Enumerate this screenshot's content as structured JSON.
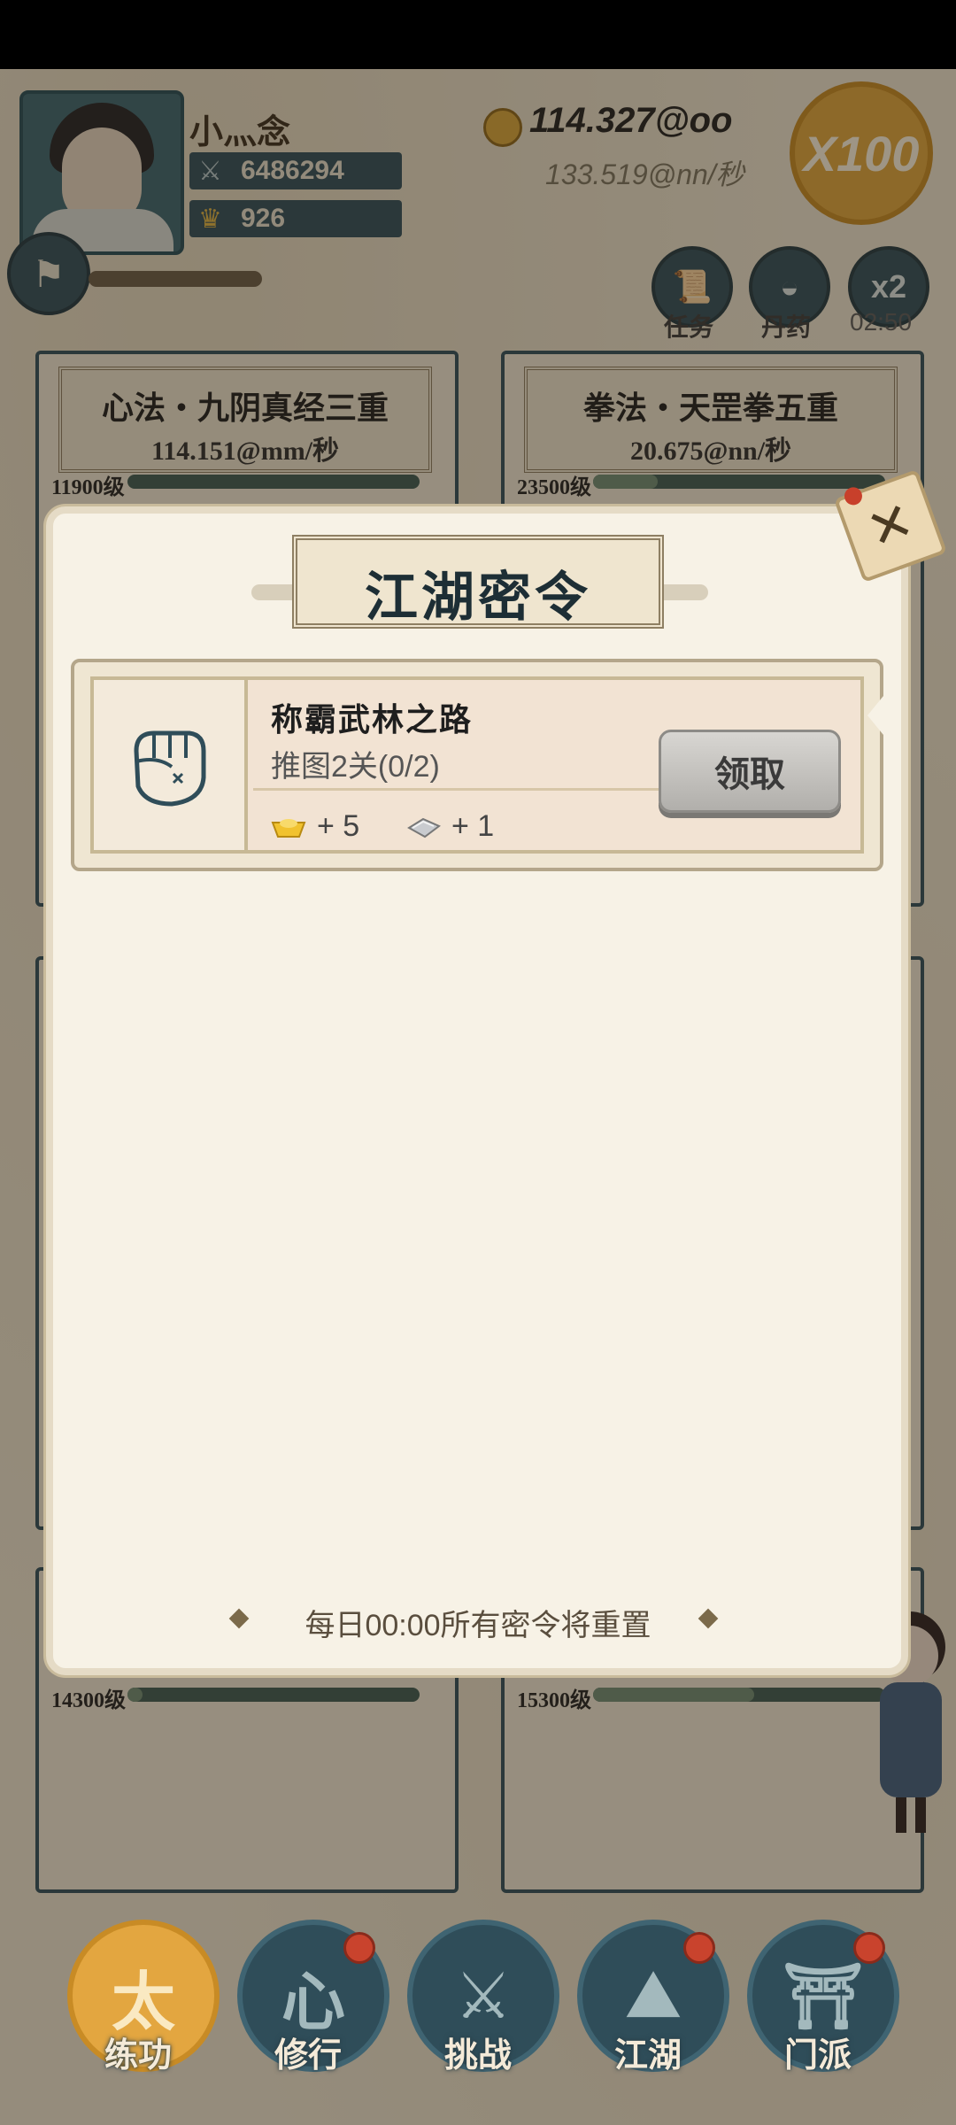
{
  "player": {
    "name": "小灬念",
    "power": "6486294",
    "ingots": "926"
  },
  "currency": {
    "gold": "114.327@oo",
    "rate": "133.519@nn/秒",
    "multiplier": "X100"
  },
  "actions": [
    {
      "icon": "scroll-icon",
      "label": "任务"
    },
    {
      "icon": "pill-icon",
      "label": "丹药"
    },
    {
      "icon": "speed-icon",
      "label": "x2",
      "timer": "02:50"
    }
  ],
  "cards": [
    {
      "title": "心法・九阴真经三重",
      "rate": "114.151@mm/秒",
      "level": "11900级",
      "progress": 0.0
    },
    {
      "title": "拳法・天罡拳五重",
      "rate": "20.675@nn/秒",
      "level": "23500级",
      "progress": 0.22
    },
    {
      "level": "14300级",
      "progress": 0.05
    },
    {
      "level": "15300级",
      "progress": 0.55
    }
  ],
  "modal": {
    "title": "江湖密令",
    "task": {
      "name": "称霸武林之路",
      "desc": "推图2关(0/2)",
      "reward1": "+ 5",
      "reward2": "+ 1",
      "button": "领取"
    },
    "footer": "每日00:00所有密令将重置"
  },
  "nav": [
    {
      "label": "练功",
      "icon": "martial-pose-icon",
      "active": true,
      "dot": false
    },
    {
      "label": "修行",
      "icon": "heart-icon",
      "active": false,
      "dot": true
    },
    {
      "label": "挑战",
      "icon": "crossed-swords-icon",
      "active": false,
      "dot": false
    },
    {
      "label": "江湖",
      "icon": "mountain-icon",
      "active": false,
      "dot": true
    },
    {
      "label": "门派",
      "icon": "gate-icon",
      "active": false,
      "dot": true
    }
  ],
  "colors": {
    "accent": "#e3a640",
    "teal": "#2f4d59",
    "alert": "#c9432d"
  }
}
